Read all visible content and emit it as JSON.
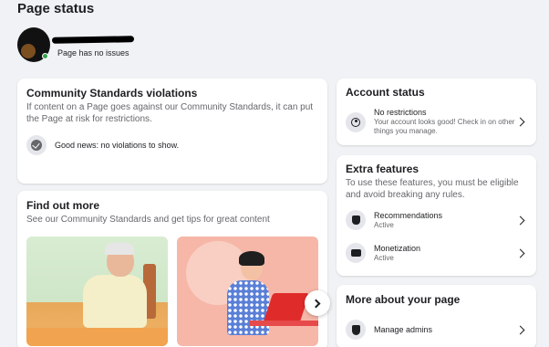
{
  "page": {
    "title": "Page status",
    "status_text": "Page has no issues"
  },
  "community_standards": {
    "title": "Community Standards violations",
    "description": "If content on a Page goes against our Community Standards, it can put the Page at risk for restrictions.",
    "result": "Good news: no violations to show."
  },
  "find_out_more": {
    "title": "Find out more",
    "description": "See our Community Standards and get tips for great content",
    "images": [
      "person-at-table-illustration",
      "person-with-laptop-illustration"
    ]
  },
  "account_status": {
    "title": "Account status",
    "item_title": "No restrictions",
    "item_desc": "Your account looks good! Check in on other things you manage."
  },
  "extra_features": {
    "title": "Extra features",
    "description": "To use these features, you must be eligible and avoid breaking any rules.",
    "items": [
      {
        "label": "Recommendations",
        "status": "Active",
        "icon": "badge-icon"
      },
      {
        "label": "Monetization",
        "status": "Active",
        "icon": "money-icon"
      }
    ]
  },
  "more_about": {
    "title": "More about your page",
    "items": [
      {
        "label": "Manage admins",
        "icon": "shield-icon"
      }
    ]
  },
  "colors": {
    "background": "#f0f2f5",
    "card": "#ffffff",
    "secondary_text": "#65676b",
    "online": "#31a24c"
  }
}
